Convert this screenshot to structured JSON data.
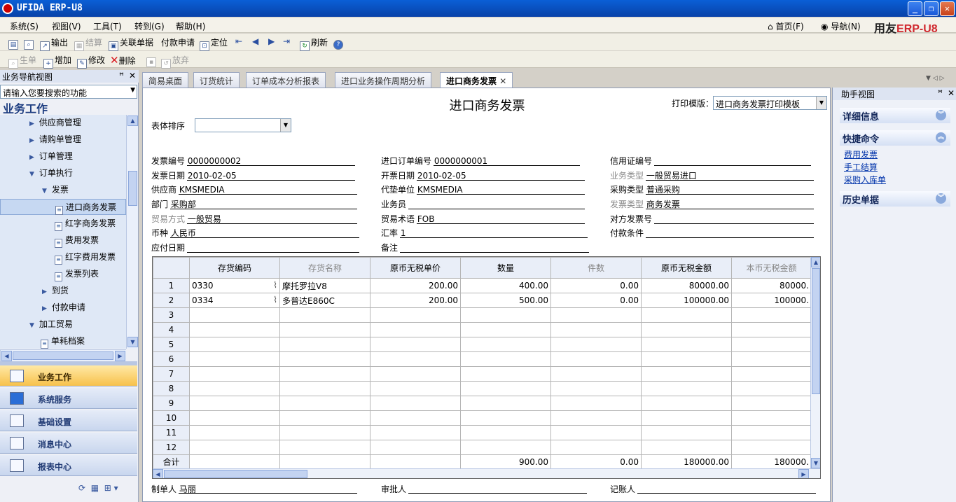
{
  "window": {
    "title": "UFIDA ERP-U8"
  },
  "menubar": {
    "items": [
      "系统(S)",
      "视图(V)",
      "工具(T)",
      "转到(G)",
      "帮助(H)"
    ],
    "right": {
      "home": "首页(F)",
      "nav": "导航(N)",
      "brand_a": "用友",
      "brand_b": "ERP-U8"
    }
  },
  "toolbar1": {
    "export": "输出",
    "settle": "结算",
    "related": "关联单据",
    "payreq": "付款申请",
    "locate": "定位",
    "refresh": "刷新"
  },
  "toolbar2": {
    "generate": "生单",
    "add": "增加",
    "edit": "修改",
    "delete": "删除",
    "abandon": "放弃"
  },
  "left": {
    "header": "业务导航视图",
    "search_placeholder": "请输入您要搜索的功能",
    "section_title": "业务工作",
    "tree": [
      "供应商管理",
      "请购单管理",
      "订单管理",
      "订单执行",
      "发票",
      "进口商务发票",
      "红字商务发票",
      "费用发票",
      "红字费用发票",
      "发票列表",
      "到货",
      "付款申请",
      "加工贸易",
      "单耗档案"
    ],
    "modules": [
      "业务工作",
      "系统服务",
      "基础设置",
      "消息中心",
      "报表中心"
    ]
  },
  "tabs": [
    "简易桌面",
    "订货统计",
    "订单成本分析报表",
    "进口业务操作周期分析",
    "进口商务发票"
  ],
  "doc": {
    "title": "进口商务发票",
    "print_template_label": "打印模版：",
    "print_template_value": "进口商务发票打印模板",
    "sort_label": "表体排序",
    "fields": {
      "invoice_no_l": "发票编号",
      "invoice_no_v": "0000000002",
      "order_no_l": "进口订单编号",
      "order_no_v": "0000000001",
      "lc_no_l": "信用证编号",
      "lc_no_v": "",
      "invoice_date_l": "发票日期",
      "invoice_date_v": "2010-02-05",
      "issue_date_l": "开票日期",
      "issue_date_v": "2010-02-05",
      "biz_type_l": "业务类型",
      "biz_type_v": "一般贸易进口",
      "supplier_l": "供应商",
      "supplier_v": "KMSMEDIA",
      "payer_l": "代垫单位",
      "payer_v": "KMSMEDIA",
      "purchase_type_l": "采购类型",
      "purchase_type_v": "普通采购",
      "dept_l": "部门",
      "dept_v": "采购部",
      "staff_l": "业务员",
      "staff_v": "",
      "invoice_type_l": "发票类型",
      "invoice_type_v": "商务发票",
      "trade_mode_l": "贸易方式",
      "trade_mode_v": "一般贸易",
      "trade_term_l": "贸易术语",
      "trade_term_v": "FOB",
      "peer_invoice_l": "对方发票号",
      "peer_invoice_v": "",
      "currency_l": "币种",
      "currency_v": "人民币",
      "rate_l": "汇率",
      "rate_v": "1",
      "pay_terms_l": "付款条件",
      "pay_terms_v": "",
      "due_date_l": "应付日期",
      "due_date_v": "",
      "remark_l": "备注",
      "remark_v": ""
    },
    "grid": {
      "headers": [
        "存货编码",
        "存货名称",
        "原币无税单价",
        "数量",
        "件数",
        "原币无税金额",
        "本币无税金额"
      ],
      "rows": [
        {
          "no": "1",
          "code": "0330",
          "name": "摩托罗拉V8",
          "price": "200.00",
          "qty": "400.00",
          "pieces": "0.00",
          "amount": "80000.00",
          "local": "80000."
        },
        {
          "no": "2",
          "code": "0334",
          "name": "多普达E860C",
          "price": "200.00",
          "qty": "500.00",
          "pieces": "0.00",
          "amount": "100000.00",
          "local": "100000."
        },
        {
          "no": "3"
        },
        {
          "no": "4"
        },
        {
          "no": "5"
        },
        {
          "no": "6"
        },
        {
          "no": "7"
        },
        {
          "no": "8"
        },
        {
          "no": "9"
        },
        {
          "no": "10"
        },
        {
          "no": "11"
        },
        {
          "no": "12"
        }
      ],
      "total": {
        "label": "合计",
        "qty": "900.00",
        "pieces": "0.00",
        "amount": "180000.00",
        "local": "180000."
      }
    },
    "footer": {
      "maker_l": "制单人",
      "maker_v": "马丽",
      "approver_l": "审批人",
      "approver_v": "",
      "bookkeeper_l": "记账人",
      "bookkeeper_v": ""
    }
  },
  "right": {
    "header": "助手视图",
    "sections": {
      "detail": "详细信息",
      "quick": "快捷命令",
      "history": "历史单据"
    },
    "quick_links": [
      "费用发票",
      "手工结算",
      "采购入库单"
    ]
  }
}
